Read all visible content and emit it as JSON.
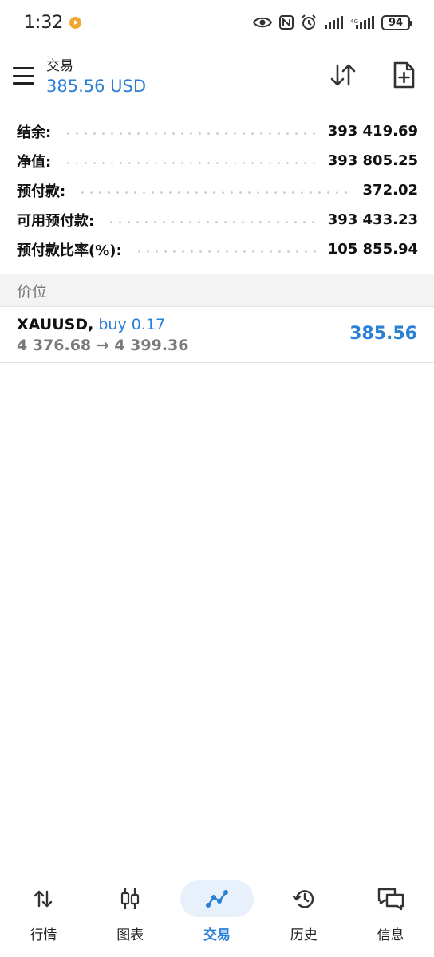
{
  "status_bar": {
    "time": "1:32",
    "battery": "94"
  },
  "header": {
    "title": "交易",
    "balance": "385.56 USD"
  },
  "summary": [
    {
      "label": "结余:",
      "value": "393 419.69"
    },
    {
      "label": "净值:",
      "value": "393 805.25"
    },
    {
      "label": "预付款:",
      "value": "372.02"
    },
    {
      "label": "可用预付款:",
      "value": "393 433.23"
    },
    {
      "label": "预付款比率(%):",
      "value": "105 855.94"
    }
  ],
  "section": {
    "title": "价位"
  },
  "position": {
    "symbol": "XAUUSD,",
    "side": "buy 0.17",
    "price_open": "4 376.68",
    "arrow": "→",
    "price_current": "4 399.36",
    "profit": "385.56"
  },
  "bottom_nav": [
    {
      "label": "行情",
      "icon": "quotes-arrows-icon",
      "active": false
    },
    {
      "label": "图表",
      "icon": "candlestick-icon",
      "active": false
    },
    {
      "label": "交易",
      "icon": "trade-line-icon",
      "active": true
    },
    {
      "label": "历史",
      "icon": "history-clock-icon",
      "active": false
    },
    {
      "label": "信息",
      "icon": "messages-icon",
      "active": false
    }
  ],
  "colors": {
    "accent": "#2a7fd6",
    "muted": "#7a7a7a",
    "section_bg": "#f3f3f3"
  }
}
